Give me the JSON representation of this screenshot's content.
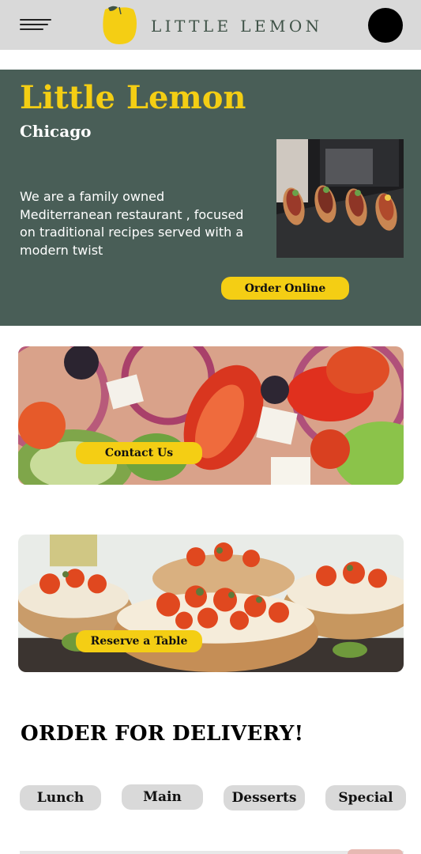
{
  "header": {
    "brand": "LITTLE LEMON",
    "menu_icon": "hamburger-menu-icon",
    "logo_icon": "lemon-logo-icon",
    "avatar_icon": "profile-avatar"
  },
  "hero": {
    "title": "Little Lemon",
    "subtitle": "Chicago",
    "description": "We are a family owned Mediterranean restaurant , focused on traditional recipes served with a modern twist",
    "cta_label": "Order Online",
    "photo_icon": "food-platter-photo"
  },
  "cards": [
    {
      "image": "greek-salad-photo",
      "button_label": "Contact Us"
    },
    {
      "image": "bruschetta-photo",
      "button_label": "Reserve a Table"
    }
  ],
  "delivery": {
    "title": "ORDER FOR DELIVERY!",
    "categories": [
      "Lunch",
      "Main",
      "Desserts",
      "Special"
    ]
  },
  "colors": {
    "primary_green": "#495e57",
    "primary_yellow": "#f4ce14",
    "header_gray": "#d9d9d9"
  }
}
